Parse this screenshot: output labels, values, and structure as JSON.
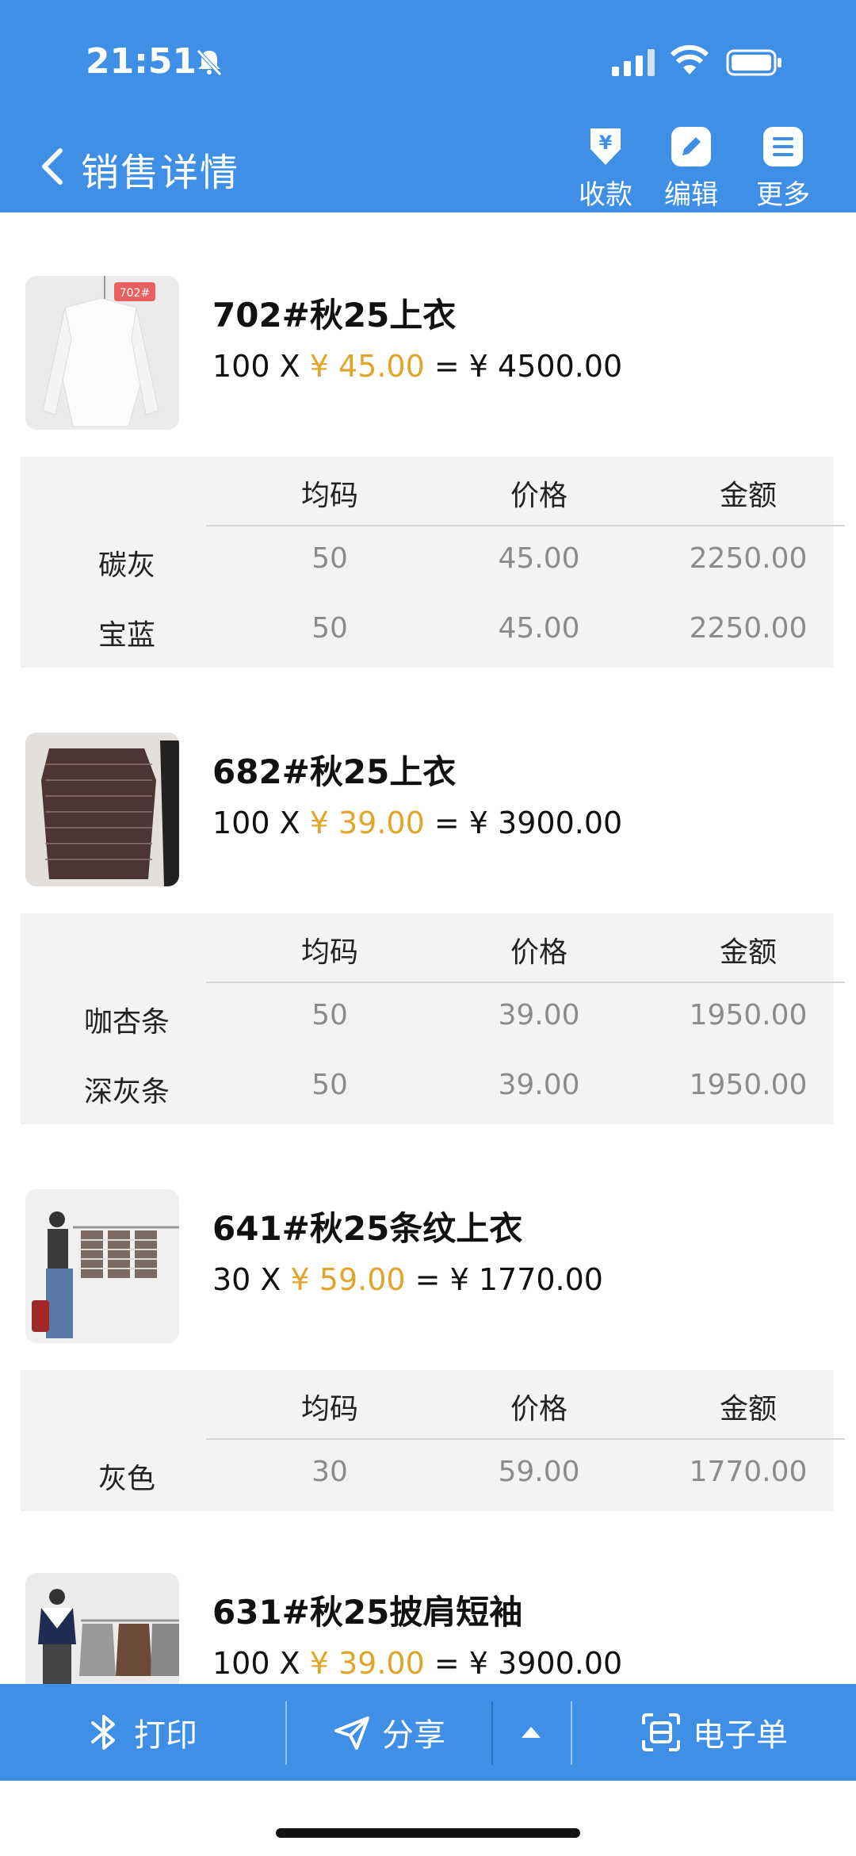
{
  "status_bar": {
    "time": "21:51"
  },
  "header": {
    "title": "销售详情",
    "actions": [
      {
        "label": "收款",
        "icon": "yen-download-icon"
      },
      {
        "label": "编辑",
        "icon": "edit-icon"
      },
      {
        "label": "更多",
        "icon": "menu-icon"
      }
    ]
  },
  "columns": {
    "size": "均码",
    "price": "价格",
    "amount": "金额"
  },
  "items": [
    {
      "name": "702#秋25上衣",
      "qty": "100 X ",
      "price": "¥ 45.00",
      "total": " = ¥ 4500.00",
      "thumb_tag": "702#",
      "rows": [
        {
          "color": "碳灰",
          "size": "50",
          "price": "45.00",
          "amount": "2250.00"
        },
        {
          "color": "宝蓝",
          "size": "50",
          "price": "45.00",
          "amount": "2250.00"
        }
      ]
    },
    {
      "name": "682#秋25上衣",
      "qty": "100 X ",
      "price": "¥ 39.00",
      "total": " = ¥ 3900.00",
      "rows": [
        {
          "color": "咖杏条",
          "size": "50",
          "price": "39.00",
          "amount": "1950.00"
        },
        {
          "color": "深灰条",
          "size": "50",
          "price": "39.00",
          "amount": "1950.00"
        }
      ]
    },
    {
      "name": "641#秋25条纹上衣",
      "qty": "30 X ",
      "price": "¥ 59.00",
      "total": " = ¥ 1770.00",
      "rows": [
        {
          "color": "灰色",
          "size": "30",
          "price": "59.00",
          "amount": "1770.00"
        }
      ]
    },
    {
      "name": "631#秋25披肩短袖",
      "qty": "100 X ",
      "price": "¥ 39.00",
      "total": " = ¥ 3900.00"
    }
  ],
  "bottom_bar": {
    "print": "打印",
    "share": "分享",
    "e_bill": "电子单"
  },
  "colors": {
    "primary": "#3f8fe6",
    "price_accent": "#e0a52a"
  }
}
